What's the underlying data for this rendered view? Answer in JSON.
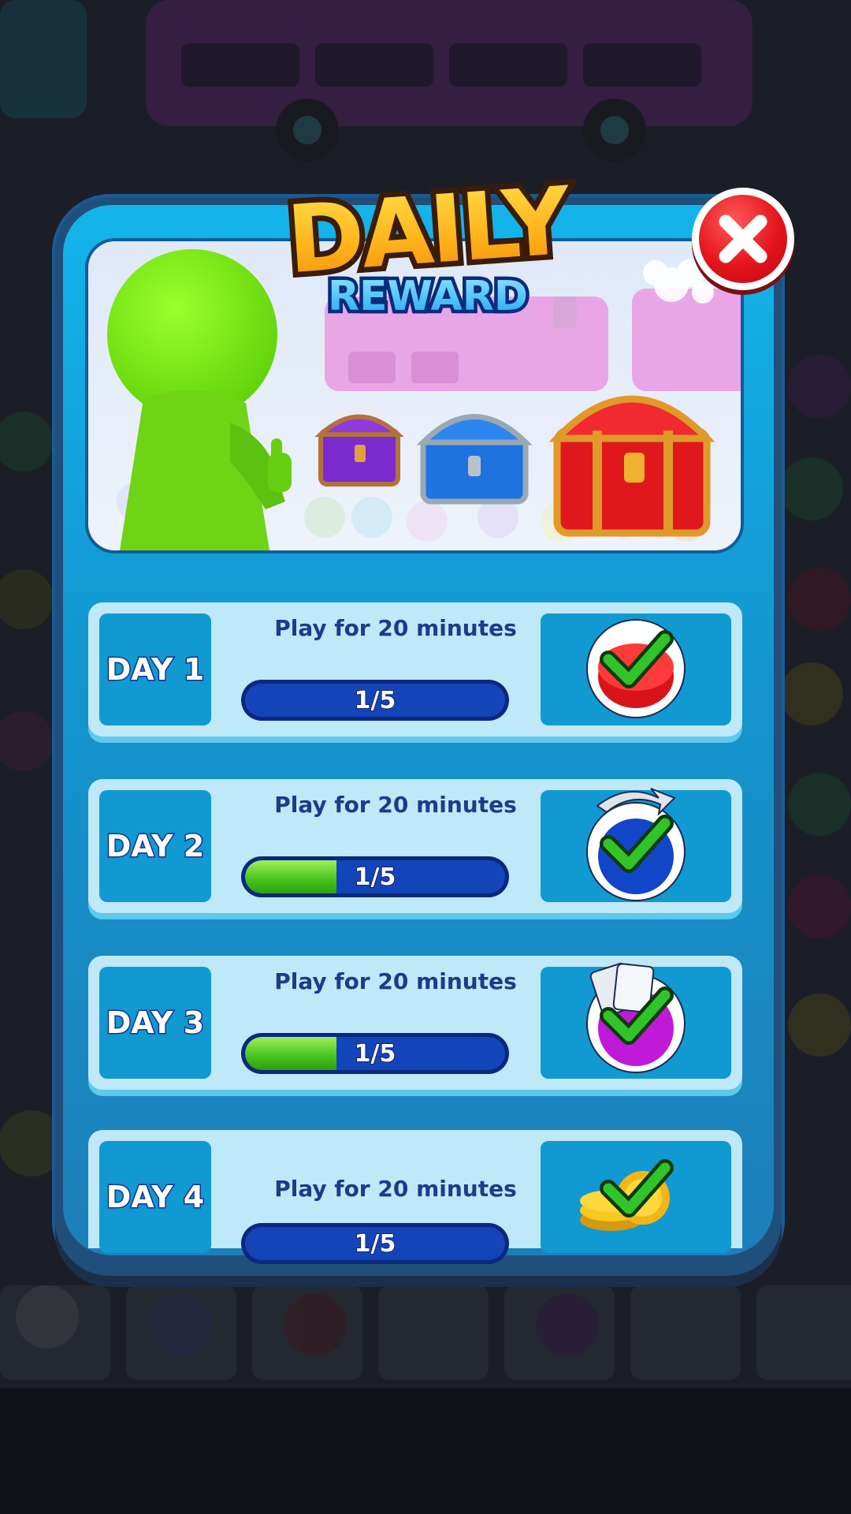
{
  "title": {
    "line1": "DAILY",
    "line2": "REWARD"
  },
  "close_button": {
    "icon": "close-icon"
  },
  "banner": {
    "characters": "green-stickman-thumbs-up",
    "chests": [
      "purple-chest",
      "blue-chest",
      "red-chest"
    ]
  },
  "days": [
    {
      "label": "DAY 1",
      "task": "Play for 20 minutes",
      "progress_text": "1/5",
      "progress": 0.0,
      "reward_icon": "red-button-check-icon"
    },
    {
      "label": "DAY 2",
      "task": "Play for 20 minutes",
      "progress_text": "1/5",
      "progress": 0.35,
      "reward_icon": "blue-arrows-check-icon"
    },
    {
      "label": "DAY 3",
      "task": "Play for 20 minutes",
      "progress_text": "1/5",
      "progress": 0.35,
      "reward_icon": "purple-cards-check-icon"
    },
    {
      "label": "DAY 4",
      "task": "Play for 20 minutes",
      "progress_text": "1/5",
      "progress": 0.0,
      "reward_icon": "gold-coins-check-icon"
    }
  ],
  "colors": {
    "panel": "#1395cf",
    "row": "#bfe8f8",
    "bar": "#1445b8",
    "bar_fill": "#44c21b",
    "accent_red": "#e4141b"
  }
}
